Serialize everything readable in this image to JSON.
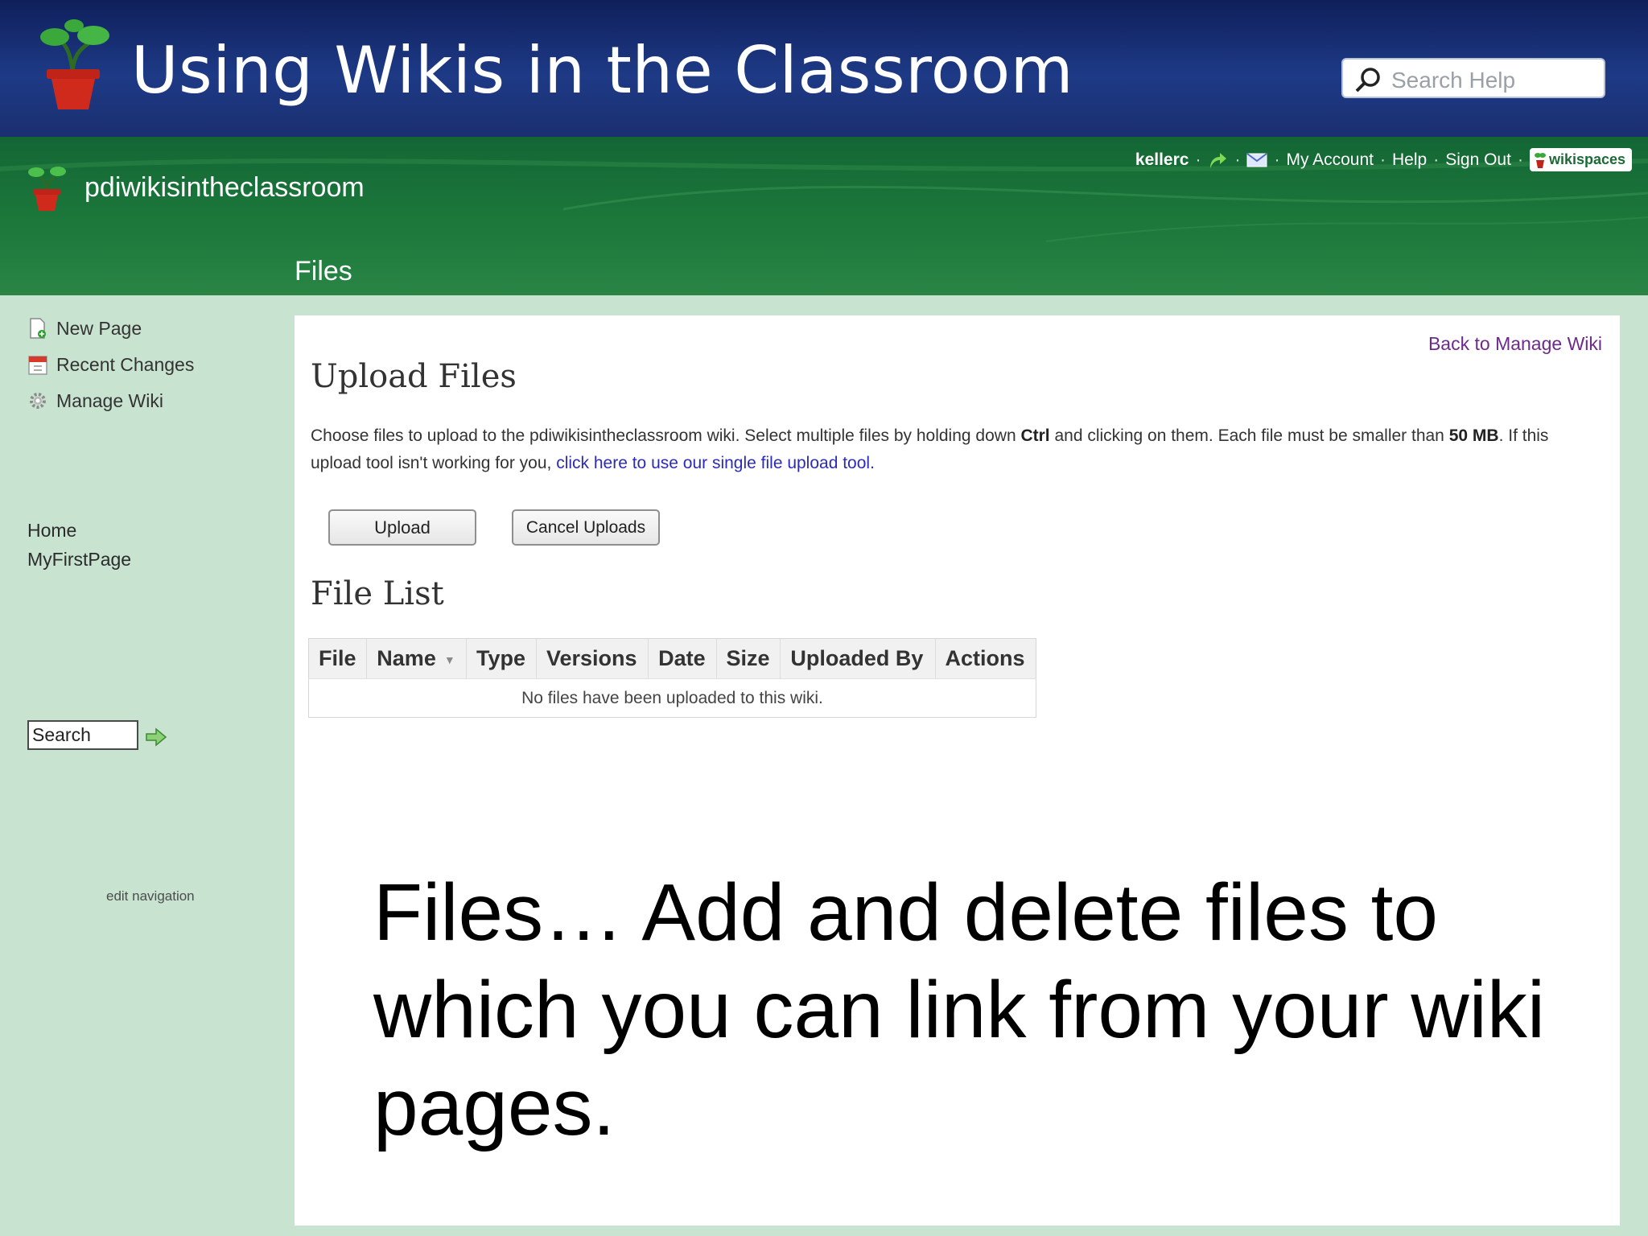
{
  "slide": {
    "title": "Using Wikis in the Classroom",
    "search_placeholder": "Search Help"
  },
  "header": {
    "wiki_name": "pdiwikisintheclassroom",
    "page_heading": "Files",
    "user_bar": {
      "username": "kellerc",
      "my_account": "My Account",
      "help": "Help",
      "sign_out": "Sign Out",
      "brand": "wikispaces"
    }
  },
  "sidebar": {
    "actions": [
      {
        "label": "New Page",
        "icon": "new-page-icon"
      },
      {
        "label": "Recent Changes",
        "icon": "calendar-icon"
      },
      {
        "label": "Manage Wiki",
        "icon": "gear-icon"
      }
    ],
    "search_value": "Search",
    "nav": [
      {
        "label": "Home"
      },
      {
        "label": "MyFirstPage"
      }
    ],
    "edit_navigation": "edit navigation"
  },
  "main": {
    "back_link": "Back to Manage Wiki",
    "upload_heading": "Upload Files",
    "instructions": {
      "part1": "Choose files to upload to the pdiwikisintheclassroom wiki. Select multiple files by holding down ",
      "ctrl": "Ctrl",
      "part2": " and clicking on them. Each file must be smaller than ",
      "size": "50 MB",
      "part3": ". If this upload tool isn't working for you, ",
      "link": "click here to use our single file upload tool",
      "end": "."
    },
    "upload_button": "Upload",
    "cancel_button": "Cancel Uploads",
    "file_list_heading": "File List",
    "table": {
      "columns": [
        "File",
        "Name",
        "Type",
        "Versions",
        "Date",
        "Size",
        "Uploaded By",
        "Actions"
      ],
      "empty_message": "No files have been uploaded to this wiki."
    }
  },
  "caption": "Files… Add and delete files to which you can link from your wiki pages.",
  "colors": {
    "banner": "#1e3a86",
    "wiki_green": "#1d7a3c",
    "sidebar_bg": "#c8e4d0",
    "link_blue": "#2b2bb8",
    "back_link_purple": "#6e2a8a"
  }
}
